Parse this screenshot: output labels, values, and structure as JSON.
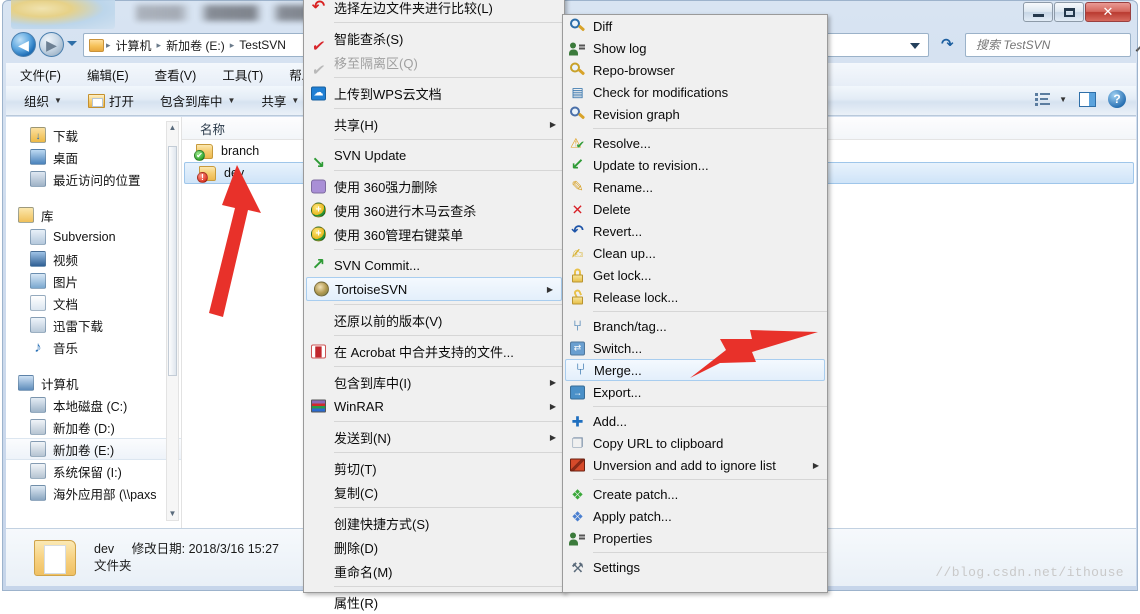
{
  "window": {
    "title": "",
    "buttons": {
      "minimize": "–",
      "maximize": "❑",
      "close": "✕"
    }
  },
  "nav": {
    "back_icon": "back-arrow-icon",
    "forward_icon": "forward-arrow-icon",
    "recent_dropdown": "recent-locations-icon",
    "breadcrumbs": [
      "计算机",
      "新加卷 (E:)",
      "TestSVN"
    ],
    "separator": "▸",
    "refresh_label": "↻",
    "search_placeholder": "搜索 TestSVN",
    "search_value": ""
  },
  "menubar": {
    "items": [
      "文件(F)",
      "编辑(E)",
      "查看(V)",
      "工具(T)",
      "帮助(H)"
    ]
  },
  "toolbar": {
    "organize": "组织",
    "open": "打开",
    "include_library": "包含到库中",
    "share": "共享",
    "caret": "▼",
    "help_glyph": "?"
  },
  "navpane": {
    "items": [
      {
        "label": "下载",
        "icon": "downloads-icon",
        "type": "item"
      },
      {
        "label": "桌面",
        "icon": "desktop-icon",
        "type": "item"
      },
      {
        "label": "最近访问的位置",
        "icon": "recent-places-icon",
        "type": "item"
      },
      {
        "label": "",
        "icon": "",
        "type": "gap"
      },
      {
        "label": "库",
        "icon": "library-icon",
        "type": "group"
      },
      {
        "label": "Subversion",
        "icon": "subversion-library-icon",
        "type": "item"
      },
      {
        "label": "视频",
        "icon": "videos-icon",
        "type": "item"
      },
      {
        "label": "图片",
        "icon": "pictures-icon",
        "type": "item"
      },
      {
        "label": "文档",
        "icon": "documents-icon",
        "type": "item"
      },
      {
        "label": "迅雷下载",
        "icon": "thunder-download-icon",
        "type": "item"
      },
      {
        "label": "音乐",
        "icon": "music-icon",
        "type": "item"
      },
      {
        "label": "",
        "icon": "",
        "type": "gap"
      },
      {
        "label": "计算机",
        "icon": "computer-icon",
        "type": "group"
      },
      {
        "label": "本地磁盘 (C:)",
        "icon": "local-disk-icon",
        "type": "item"
      },
      {
        "label": "新加卷 (D:)",
        "icon": "drive-icon",
        "type": "item"
      },
      {
        "label": "新加卷 (E:)",
        "icon": "drive-icon",
        "type": "item-selected"
      },
      {
        "label": "系统保留 (I:)",
        "icon": "drive-icon",
        "type": "item"
      },
      {
        "label": "海外应用部 (\\\\paxs",
        "icon": "network-drive-icon",
        "type": "item"
      }
    ]
  },
  "filepane": {
    "column_header": "名称",
    "rows": [
      {
        "name": "branch",
        "overlay": "svn-normal-overlay",
        "selected": false
      },
      {
        "name": "dev",
        "overlay": "svn-modified-overlay",
        "selected": true
      }
    ]
  },
  "details": {
    "name": "dev",
    "modified_label": "修改日期:",
    "modified_value": "2018/3/16 15:27",
    "type": "文件夹"
  },
  "watermark": "//blog.csdn.net/ithouse",
  "context_menu": {
    "items": [
      {
        "label": "选择左边文件夹进行比较(L)",
        "icon": "beyond-compare-left-icon",
        "type": "item"
      },
      {
        "type": "separator"
      },
      {
        "label": "智能查杀(S)",
        "icon": "kingsoft-scan-icon",
        "type": "item"
      },
      {
        "label": "移至隔离区(Q)",
        "icon": "quarantine-icon",
        "type": "disabled"
      },
      {
        "type": "separator"
      },
      {
        "label": "上传到WPS云文档",
        "icon": "wps-cloud-icon",
        "type": "item"
      },
      {
        "type": "separator"
      },
      {
        "label": "共享(H)",
        "icon": "",
        "type": "submenu"
      },
      {
        "type": "separator"
      },
      {
        "label": "SVN Update",
        "icon": "svn-update-icon",
        "type": "item"
      },
      {
        "type": "separator"
      },
      {
        "label": "使用 360强力删除",
        "icon": "360-force-delete-icon",
        "type": "item"
      },
      {
        "label": "使用 360进行木马云查杀",
        "icon": "360-scan-icon",
        "type": "item"
      },
      {
        "label": "使用 360管理右键菜单",
        "icon": "360-menu-manager-icon",
        "type": "item"
      },
      {
        "type": "separator"
      },
      {
        "label": "SVN Commit...",
        "icon": "svn-commit-icon",
        "type": "item"
      },
      {
        "label": "TortoiseSVN",
        "icon": "tortoisesvn-icon",
        "type": "submenu-highlight"
      },
      {
        "type": "separator"
      },
      {
        "label": "还原以前的版本(V)",
        "icon": "",
        "type": "item"
      },
      {
        "type": "separator"
      },
      {
        "label": "在 Acrobat 中合并支持的文件...",
        "icon": "acrobat-icon",
        "type": "item"
      },
      {
        "type": "separator"
      },
      {
        "label": "包含到库中(I)",
        "icon": "",
        "type": "submenu"
      },
      {
        "label": "WinRAR",
        "icon": "winrar-icon",
        "type": "submenu"
      },
      {
        "type": "separator"
      },
      {
        "label": "发送到(N)",
        "icon": "",
        "type": "submenu"
      },
      {
        "type": "separator"
      },
      {
        "label": "剪切(T)",
        "icon": "",
        "type": "item"
      },
      {
        "label": "复制(C)",
        "icon": "",
        "type": "item"
      },
      {
        "type": "separator"
      },
      {
        "label": "创建快捷方式(S)",
        "icon": "",
        "type": "item"
      },
      {
        "label": "删除(D)",
        "icon": "",
        "type": "item"
      },
      {
        "label": "重命名(M)",
        "icon": "",
        "type": "item"
      },
      {
        "type": "separator"
      },
      {
        "label": "属性(R)",
        "icon": "",
        "type": "item"
      }
    ]
  },
  "svn_submenu": {
    "items": [
      {
        "label": "Diff",
        "icon": "diff-icon",
        "type": "item"
      },
      {
        "label": "Show log",
        "icon": "show-log-icon",
        "type": "item"
      },
      {
        "label": "Repo-browser",
        "icon": "repo-browser-icon",
        "type": "item"
      },
      {
        "label": "Check for modifications",
        "icon": "check-modifications-icon",
        "type": "item"
      },
      {
        "label": "Revision graph",
        "icon": "revision-graph-icon",
        "type": "item"
      },
      {
        "type": "separator"
      },
      {
        "label": "Resolve...",
        "icon": "resolve-icon",
        "type": "item"
      },
      {
        "label": "Update to revision...",
        "icon": "update-to-revision-icon",
        "type": "item"
      },
      {
        "label": "Rename...",
        "icon": "rename-icon",
        "type": "item"
      },
      {
        "label": "Delete",
        "icon": "delete-icon",
        "type": "item"
      },
      {
        "label": "Revert...",
        "icon": "revert-icon",
        "type": "item"
      },
      {
        "label": "Clean up...",
        "icon": "cleanup-icon",
        "type": "item"
      },
      {
        "label": "Get lock...",
        "icon": "get-lock-icon",
        "type": "item"
      },
      {
        "label": "Release lock...",
        "icon": "release-lock-icon",
        "type": "item"
      },
      {
        "type": "separator"
      },
      {
        "label": "Branch/tag...",
        "icon": "branch-tag-icon",
        "type": "item"
      },
      {
        "label": "Switch...",
        "icon": "switch-icon",
        "type": "item"
      },
      {
        "label": "Merge...",
        "icon": "merge-icon",
        "type": "highlight"
      },
      {
        "label": "Export...",
        "icon": "export-icon",
        "type": "item"
      },
      {
        "type": "separator"
      },
      {
        "label": "Add...",
        "icon": "add-icon",
        "type": "item"
      },
      {
        "label": "Copy URL to clipboard",
        "icon": "copy-url-icon",
        "type": "item"
      },
      {
        "label": "Unversion and add to ignore list",
        "icon": "unversion-ignore-icon",
        "type": "submenu"
      },
      {
        "type": "separator"
      },
      {
        "label": "Create patch...",
        "icon": "create-patch-icon",
        "type": "item"
      },
      {
        "label": "Apply patch...",
        "icon": "apply-patch-icon",
        "type": "item"
      },
      {
        "label": "Properties",
        "icon": "properties-icon",
        "type": "item"
      },
      {
        "type": "separator"
      },
      {
        "label": "Settings",
        "icon": "settings-icon",
        "type": "item"
      }
    ]
  },
  "annotations": [
    {
      "name": "arrow-to-dev-folder",
      "color": "#e8312a"
    },
    {
      "name": "arrow-to-merge-item",
      "color": "#e8312a"
    }
  ]
}
